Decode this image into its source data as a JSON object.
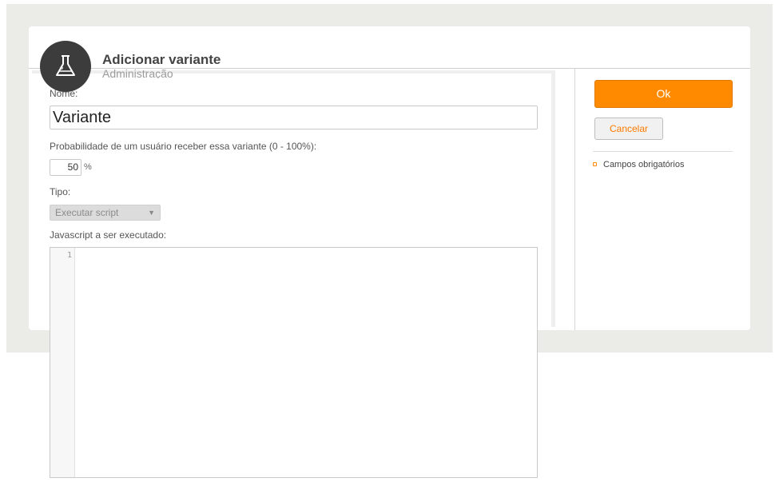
{
  "header": {
    "title": "Adicionar variante",
    "subtitle": "Administração",
    "icon": "flask-icon"
  },
  "form": {
    "name_label": "Nome:",
    "name_value": "Variante",
    "probability_label": "Probabilidade de um usuário receber essa variante (0 - 100%):",
    "probability_value": "50",
    "probability_unit": "%",
    "type_label": "Tipo:",
    "type_selected": "Executar script",
    "script_label": "Javascript a ser executado:",
    "editor_line_number": "1"
  },
  "sidebar": {
    "ok_label": "Ok",
    "cancel_label": "Cancelar",
    "required_note": "Campos obrigatórios"
  },
  "colors": {
    "accent": "#ff8a00",
    "avatar_bg": "#3c3c3c"
  }
}
